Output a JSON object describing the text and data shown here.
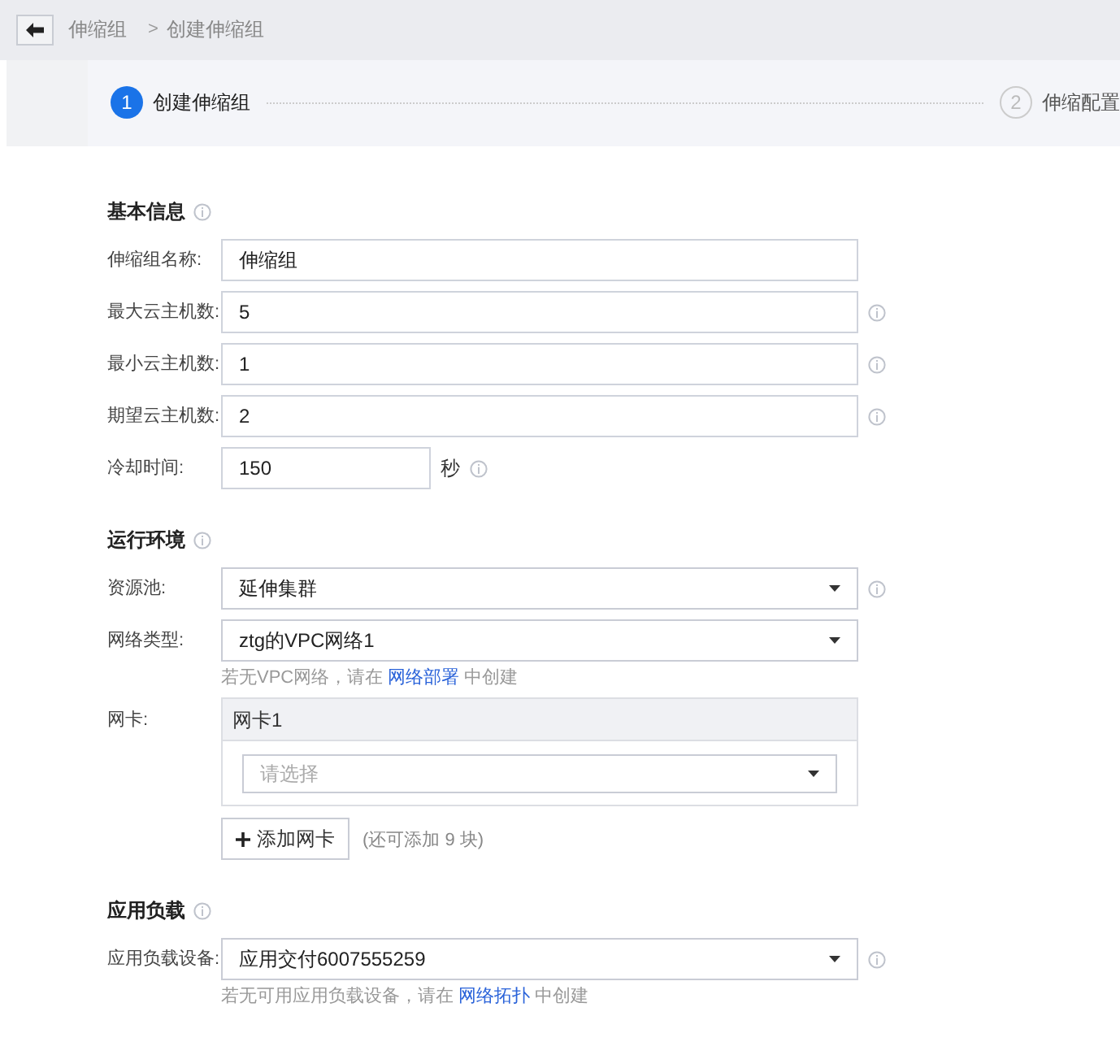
{
  "breadcrumb": {
    "parent": "伸缩组",
    "separator": ">",
    "current": "创建伸缩组"
  },
  "steps": [
    {
      "number": "1",
      "label": "创建伸缩组",
      "selected": true
    },
    {
      "number": "2",
      "label": "伸缩配置",
      "selected": false
    }
  ],
  "sections": [
    {
      "title": "基本信息",
      "info": true,
      "rows": [
        {
          "kind": "text",
          "label": "伸缩组名称:",
          "value": "伸缩组",
          "info": false
        },
        {
          "kind": "text",
          "label": "最大云主机数:",
          "value": "5",
          "info": true
        },
        {
          "kind": "text",
          "label": "最小云主机数:",
          "value": "1",
          "info": true
        },
        {
          "kind": "text",
          "label": "期望云主机数:",
          "value": "2",
          "info": true
        },
        {
          "kind": "short",
          "label": "冷却时间:",
          "value": "150",
          "suffix": "秒",
          "info": true
        }
      ]
    },
    {
      "title": "运行环境",
      "info": true,
      "rows": [
        {
          "kind": "select",
          "label": "资源池:",
          "value": "延伸集群",
          "info": true
        },
        {
          "kind": "select",
          "label": "网络类型:",
          "value": "ztg的VPC网络1",
          "info": false,
          "hint": {
            "before": "若无VPC网络，请在",
            "link": "网络部署",
            "after": "中创建"
          }
        },
        {
          "kind": "nic",
          "label": "网卡:",
          "header": "网卡1",
          "placeholder": "请选择",
          "button": "添加网卡",
          "note": "(还可添加 9 块)"
        }
      ]
    },
    {
      "title": "应用负载",
      "info": true,
      "rows": [
        {
          "kind": "select",
          "label": "应用负载设备:",
          "value": "应用交付6007555259",
          "info": true,
          "hint": {
            "before": "若无可用应用负载设备，请在",
            "link": "网络拓扑",
            "after": "中创建"
          }
        }
      ]
    }
  ]
}
